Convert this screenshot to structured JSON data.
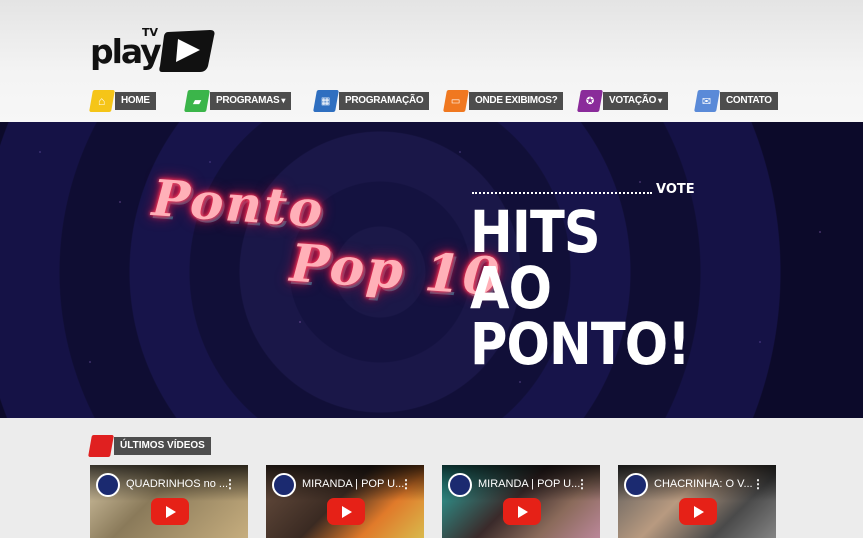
{
  "logo": {
    "text": "play",
    "tv": "TV"
  },
  "nav": [
    {
      "label": "HOME",
      "icon": "home-icon",
      "color": "#f5c518",
      "caret": ""
    },
    {
      "label": "PROGRAMAS",
      "icon": "programs-icon",
      "color": "#3bb54a",
      "caret": "▾"
    },
    {
      "label": "PROGRAMAÇÃO",
      "icon": "calendar-icon",
      "color": "#2f6fc0",
      "caret": ""
    },
    {
      "label": "ONDE EXIBIMOS?",
      "icon": "tv-icon",
      "color": "#f07820",
      "caret": ""
    },
    {
      "label": "VOTAÇÃO",
      "icon": "award-icon",
      "color": "#8a2b9a",
      "caret": "▾"
    },
    {
      "label": "CONTATO",
      "icon": "mail-icon",
      "color": "#5a8ad8",
      "caret": ""
    }
  ],
  "banner": {
    "line1": "Ponto",
    "line2": "Pop 10",
    "vote": "VOTE",
    "headline_1": "HITS AO",
    "headline_2": "PONTO!"
  },
  "section": {
    "title": "ÚLTIMOS VÍDEOS"
  },
  "videos": [
    {
      "title": "QUADRINHOS no ...",
      "more": "⋮"
    },
    {
      "title": "MIRANDA | POP U...",
      "more": "⋮"
    },
    {
      "title": "MIRANDA | POP U...",
      "more": "⋮"
    },
    {
      "title": "CHACRINHA: O V...",
      "more": "⋮"
    }
  ],
  "colors": {
    "nav_bg": "#4d4d4d",
    "banner_bg": "#141240",
    "play_red": "#e62117"
  }
}
